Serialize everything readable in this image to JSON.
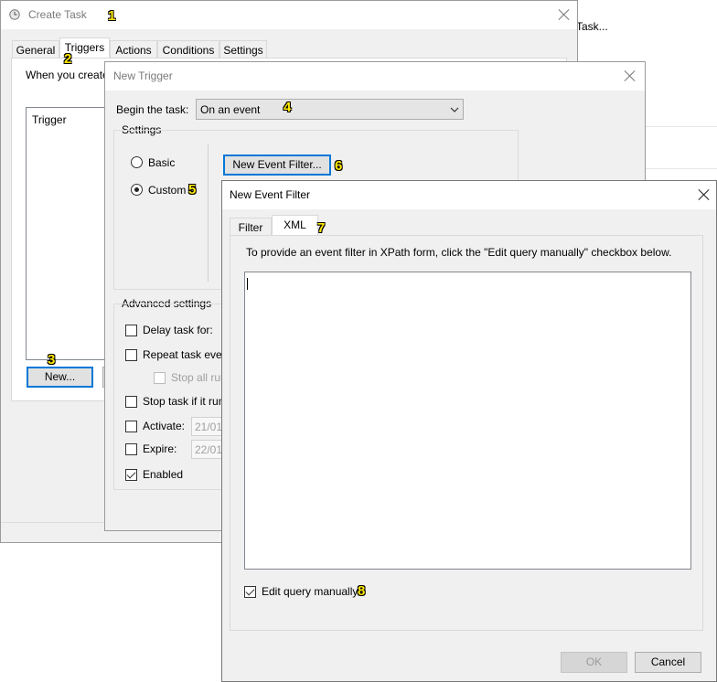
{
  "background_window": {
    "task_label": "Task..."
  },
  "create_task": {
    "title": "Create Task",
    "tabs": [
      "General",
      "Triggers",
      "Actions",
      "Conditions",
      "Settings"
    ],
    "intro_text": "When you create",
    "list_header": "Trigger",
    "new_button": "New..."
  },
  "new_trigger": {
    "title": "New Trigger",
    "begin_label": "Begin the task:",
    "begin_value": "On an event",
    "settings_label": "Settings",
    "basic_label": "Basic",
    "custom_label": "Custom",
    "new_event_filter_button": "New Event Filter...",
    "advanced_label": "Advanced settings",
    "delay_label": "Delay task for:",
    "repeat_label": "Repeat task every",
    "stop_all_label": "Stop all rur",
    "stop_if_label": "Stop task if it run",
    "activate_label": "Activate:",
    "activate_value": "21/01/",
    "expire_label": "Expire:",
    "expire_value": "22/01/",
    "enabled_label": "Enabled"
  },
  "new_event_filter": {
    "title": "New Event Filter",
    "tabs": [
      "Filter",
      "XML"
    ],
    "instructions": "To provide an event filter in XPath form, click the \"Edit query manually\" checkbox below.",
    "edit_query_label": "Edit query manually",
    "ok_button": "OK",
    "cancel_button": "Cancel"
  },
  "annotations": [
    "1",
    "2",
    "3",
    "4",
    "5",
    "6",
    "7",
    "8"
  ]
}
